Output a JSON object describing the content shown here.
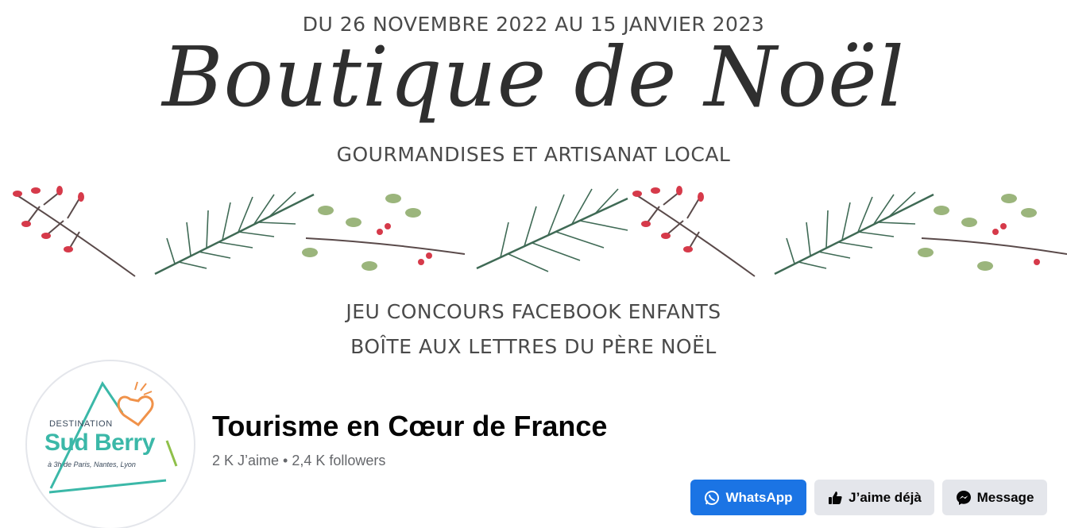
{
  "cover": {
    "dates": "DU 26 NOVEMBRE 2022 AU 15 JANVIER 2023",
    "script_title": "Boutique de Noël",
    "subtitle": "GOURMANDISES ET ARTISANAT LOCAL",
    "line1": "JEU CONCOURS FACEBOOK ENFANTS",
    "line2": "BOÎTE AUX LETTRES DU PÈRE NOËL"
  },
  "profile": {
    "logo": {
      "destination": "DESTINATION",
      "name": "Sud Berry",
      "tagline": "à 3h de Paris, Nantes, Lyon"
    },
    "name": "Tourisme en Cœur de France",
    "stats": "2 K J’aime • 2,4 K followers"
  },
  "actions": {
    "whatsapp": {
      "label": "WhatsApp",
      "icon": "whatsapp-icon"
    },
    "like": {
      "label": "J’aime déjà",
      "icon": "thumbs-up-icon"
    },
    "message": {
      "label": "Message",
      "icon": "messenger-icon"
    }
  },
  "colors": {
    "primary_button": "#1b74e4",
    "secondary_button": "#e4e6eb",
    "berry": "#d63a4a",
    "pine": "#3f6a55",
    "logo_teal": "#3bb8a8",
    "logo_orange": "#f0924a"
  }
}
